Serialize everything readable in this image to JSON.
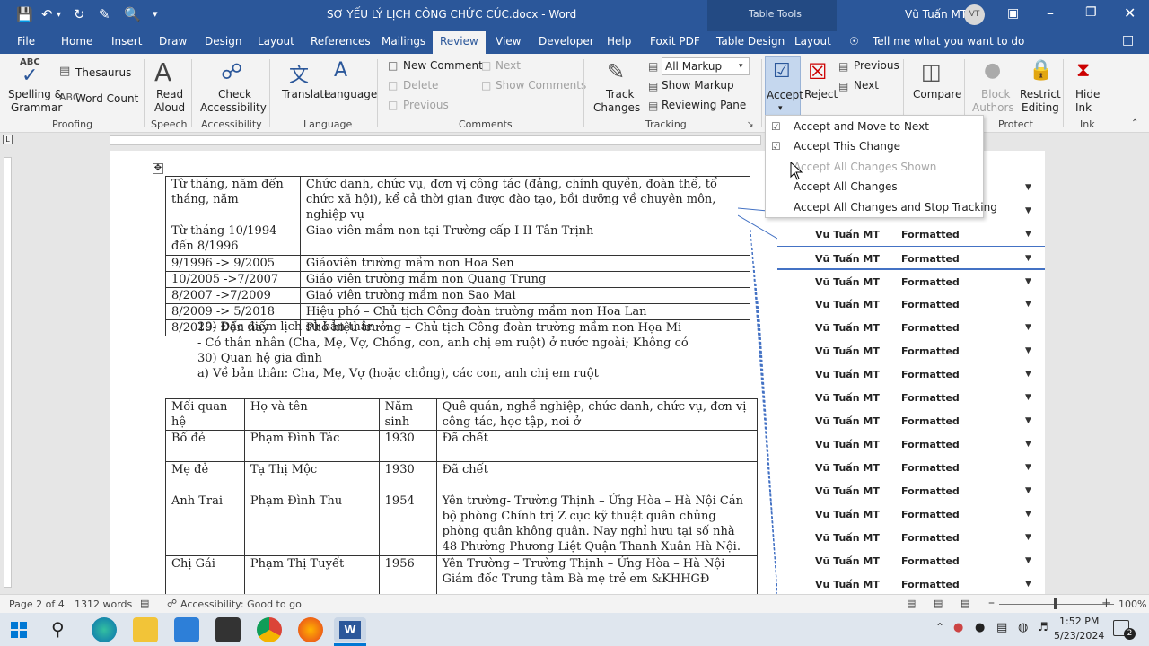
{
  "titlebar": {
    "doc_title": "SƠ YẾU LÝ LỊCH CÔNG CHỨC CÚC.docx - Word",
    "context": "Table Tools",
    "user_name": "Vũ Tuấn MT",
    "user_initials": "VT"
  },
  "tabs": {
    "file": "File",
    "home": "Home",
    "insert": "Insert",
    "draw": "Draw",
    "design": "Design",
    "layout": "Layout",
    "references": "References",
    "mailings": "Mailings",
    "review": "Review",
    "view": "View",
    "developer": "Developer",
    "help": "Help",
    "foxit": "Foxit PDF",
    "table_design": "Table Design",
    "table_layout": "Layout",
    "tellme": "Tell me what you want to do"
  },
  "ribbon": {
    "spelling1": "Spelling &",
    "spelling2": "Grammar",
    "thesaurus": "Thesaurus",
    "wordcount": "Word Count",
    "proofing": "Proofing",
    "read1": "Read",
    "read2": "Aloud",
    "speech": "Speech",
    "check1": "Check",
    "check2": "Accessibility",
    "accessibility": "Accessibility",
    "translate": "Translate",
    "language_btn": "Language",
    "language": "Language",
    "new_comment": "New Comment",
    "next": "Next",
    "delete": "Delete",
    "show_comments": "Show Comments",
    "previous": "Previous",
    "comments": "Comments",
    "track1": "Track",
    "track2": "Changes",
    "all_markup": "All Markup",
    "show_markup": "Show Markup",
    "reviewing_pane": "Reviewing Pane",
    "tracking": "Tracking",
    "accept": "Accept",
    "reject": "Reject",
    "prev_change": "Previous",
    "next_change": "Next",
    "compare": "Compare",
    "block1": "Block",
    "block2": "Authors",
    "restrict1": "Restrict",
    "restrict2": "Editing",
    "protect": "Protect",
    "hide1": "Hide",
    "hide2": "Ink",
    "ink": "Ink"
  },
  "accept_menu": {
    "items": [
      {
        "label": "Accept and Move to Next",
        "enabled": true
      },
      {
        "label": "Accept This Change",
        "enabled": true
      },
      {
        "label": "Accept All Changes Shown",
        "enabled": false
      },
      {
        "label": "Accept All Changes",
        "enabled": true
      },
      {
        "label": "Accept All Changes and Stop Tracking",
        "enabled": true
      }
    ]
  },
  "document": {
    "table1": [
      [
        "Từ tháng, năm đến tháng, năm",
        "Chức danh, chức vụ, đơn vị công tác (đảng, chính quyền, đoàn thể, tổ chức xã hội), kể cả thời gian được đào tạo, bồi dưỡng về chuyên môn, nghiệp vụ"
      ],
      [
        "Từ tháng 10/1994 đến 8/1996",
        "Giao viên mầm non tại Trường cấp I-II Tân Trịnh"
      ],
      [
        "9/1996 -> 9/2005",
        " Giáoviên trường mầm non Hoa Sen"
      ],
      [
        "10/2005 ->7/2007",
        "Giáo viên trường mầm non Quang Trung"
      ],
      [
        "8/2007 ->7/2009",
        "Giaó viên trường mầm non Sao Mai"
      ],
      [
        "8/2009 -> 5/2018",
        "Hiệu phó – Chủ tịch Công đoàn trường mầm non Hoa Lan"
      ],
      [
        "8/2019- Đến nay",
        "Phó hiệu trưởng – Chủ tịch Công đoàn trường mầm non Họa Mi"
      ]
    ],
    "line1": "29) Đặc điểm lịch sử bản thân:",
    "line2": "- Có thân nhân (Cha, Mẹ, Vợ, Chồng, con, anh chị em ruột) ở nước ngoài; Không có",
    "line3": "30) Quan hệ gia đình",
    "line4": "a) Về bản thân: Cha, Mẹ, Vợ (hoặc chồng), các con, anh chị em ruột",
    "table2": [
      [
        "Mối quan hệ",
        "Họ và tên",
        "Năm sinh",
        "Quê quán, nghề nghiệp, chức danh, chức vụ, đơn vị công tác, học tập, nơi ở"
      ],
      [
        "Bố đẻ",
        "Phạm Đình Tác",
        "1930",
        "   Đã chết"
      ],
      [
        "Mẹ đẻ",
        "Tạ Thị Mộc",
        "1930",
        "   Đã chết"
      ],
      [
        " Anh Trai",
        "Phạm Đình Thu",
        "1954",
        "Yên trường- Trường Thịnh – Ứng Hòa – Hà Nội Cán bộ phòng Chính trị Z cục kỹ thuật quân chủng phòng quân không quân. Nay nghỉ hưu tại số nhà 48 Phường Phương Liệt Quận Thanh Xuân Hà Nội."
      ],
      [
        "Chị Gái",
        "Phạm Thị Tuyết",
        "1956",
        "Yên Trường – Trường Thịnh – Ứng Hòa – Hà Nội Giám đốc Trung tâm Bà mẹ trẻ em &KHHGĐ"
      ]
    ]
  },
  "markup": {
    "rows": [
      {
        "author": "",
        "type": ""
      },
      {
        "author": "",
        "type": ""
      },
      {
        "author": "Vũ Tuấn MT",
        "type": "Formatted"
      },
      {
        "author": "Vũ Tuấn MT",
        "type": "Formatted"
      },
      {
        "author": "Vũ Tuấn MT",
        "type": "Formatted"
      },
      {
        "author": "Vũ Tuấn MT",
        "type": "Formatted"
      },
      {
        "author": "Vũ Tuấn MT",
        "type": "Formatted"
      },
      {
        "author": "Vũ Tuấn MT",
        "type": "Formatted"
      },
      {
        "author": "Vũ Tuấn MT",
        "type": "Formatted"
      },
      {
        "author": "Vũ Tuấn MT",
        "type": "Formatted"
      },
      {
        "author": "Vũ Tuấn MT",
        "type": "Formatted"
      },
      {
        "author": "Vũ Tuấn MT",
        "type": "Formatted"
      },
      {
        "author": "Vũ Tuấn MT",
        "type": "Formatted"
      },
      {
        "author": "Vũ Tuấn MT",
        "type": "Formatted"
      },
      {
        "author": "Vũ Tuấn MT",
        "type": "Formatted"
      },
      {
        "author": "Vũ Tuấn MT",
        "type": "Formatted"
      },
      {
        "author": "Vũ Tuấn MT",
        "type": "Formatted"
      },
      {
        "author": "Vũ Tuấn MT",
        "type": "Formatted"
      },
      {
        "author": "Vũ Tuấn MT",
        "type": "Formatted"
      }
    ]
  },
  "status": {
    "page": "Page 2 of 4",
    "words": "1312 words",
    "accessibility": "Accessibility: Good to go",
    "zoom": "100%"
  },
  "taskbar": {
    "time": "1:52 PM",
    "date": "5/23/2024",
    "notifications": "2"
  },
  "colors": {
    "word_blue": "#2b579a",
    "accent": "#4472c4"
  }
}
